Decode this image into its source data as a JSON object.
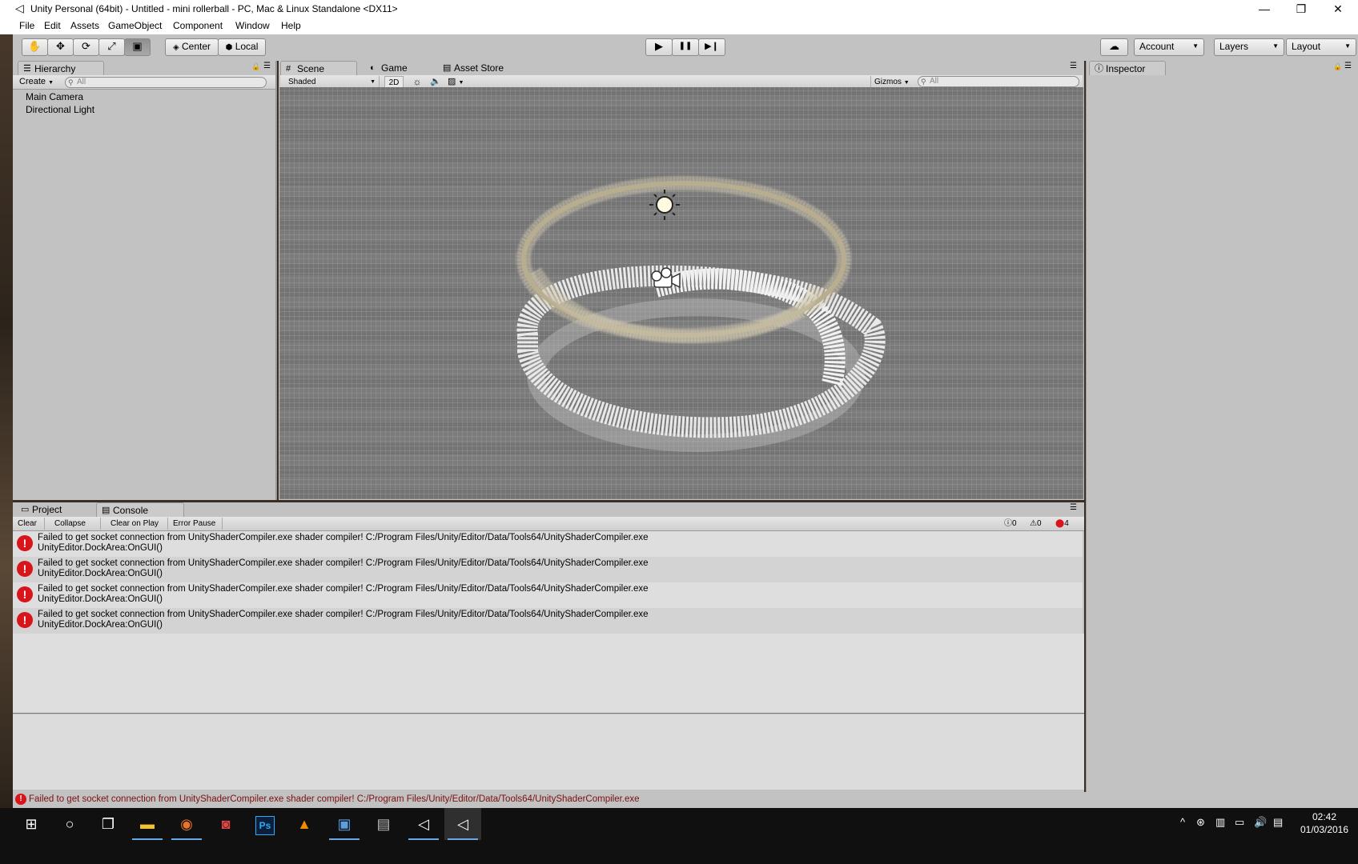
{
  "window": {
    "title": "Unity Personal (64bit) - Untitled - mini rollerball - PC, Mac & Linux Standalone <DX11>",
    "minimize": "—",
    "restore": "❐",
    "close": "✕"
  },
  "menu": [
    "File",
    "Edit",
    "Assets",
    "GameObject",
    "Component",
    "Window",
    "Help"
  ],
  "toolbar": {
    "tools": [
      "hand-icon",
      "move-icon",
      "rotate-icon",
      "scale-icon",
      "rect-icon"
    ],
    "pivot_center": "Center",
    "pivot_local": "Local",
    "play": "▶",
    "pause": "❚❚",
    "step": "▶❙",
    "cloud": "☁",
    "account": "Account",
    "layers": "Layers",
    "layout": "Layout"
  },
  "hierarchy": {
    "tab": "Hierarchy",
    "create": "Create",
    "search_placeholder": "All",
    "items": [
      "Main Camera",
      "Directional Light"
    ]
  },
  "scene": {
    "tabs": [
      "Scene",
      "Game",
      "Asset Store"
    ],
    "shading": "Shaded",
    "mode_2d": "2D",
    "gizmos": "Gizmos",
    "search_placeholder": "All"
  },
  "inspector": {
    "tab": "Inspector"
  },
  "console": {
    "tabs": [
      "Project",
      "Console"
    ],
    "buttons": [
      "Clear",
      "Collapse",
      "Clear on Play",
      "Error Pause"
    ],
    "info_count": "0",
    "warning_count": "0",
    "error_count": "4",
    "entries": [
      {
        "line1": "Failed to get socket connection from UnityShaderCompiler.exe shader compiler! C:/Program Files/Unity/Editor/Data/Tools64/UnityShaderCompiler.exe",
        "line2": "UnityEditor.DockArea:OnGUI()"
      },
      {
        "line1": "Failed to get socket connection from UnityShaderCompiler.exe shader compiler! C:/Program Files/Unity/Editor/Data/Tools64/UnityShaderCompiler.exe",
        "line2": "UnityEditor.DockArea:OnGUI()"
      },
      {
        "line1": "Failed to get socket connection from UnityShaderCompiler.exe shader compiler! C:/Program Files/Unity/Editor/Data/Tools64/UnityShaderCompiler.exe",
        "line2": "UnityEditor.DockArea:OnGUI()"
      },
      {
        "line1": "Failed to get socket connection from UnityShaderCompiler.exe shader compiler! C:/Program Files/Unity/Editor/Data/Tools64/UnityShaderCompiler.exe",
        "line2": "UnityEditor.DockArea:OnGUI()"
      }
    ]
  },
  "statusbar": {
    "message": "Failed to get socket connection from UnityShaderCompiler.exe shader compiler! C:/Program Files/Unity/Editor/Data/Tools64/UnityShaderCompiler.exe"
  },
  "taskbar": {
    "apps": [
      "windows-start-icon",
      "search-circle-icon",
      "task-view-icon",
      "file-explorer-icon",
      "firefox-icon",
      "app-red-icon",
      "photoshop-icon",
      "vlc-icon",
      "app-blue-icon",
      "app-gray-icon",
      "unity-icon",
      "unity-icon-active"
    ],
    "photoshop_label": "Ps",
    "time": "02:42",
    "date": "01/03/2016"
  },
  "colors": {
    "error_red": "#d9141b",
    "panel_gray": "#c2c2c2",
    "scene_gray": "#7b7b7b",
    "taskbar": "#101010"
  }
}
